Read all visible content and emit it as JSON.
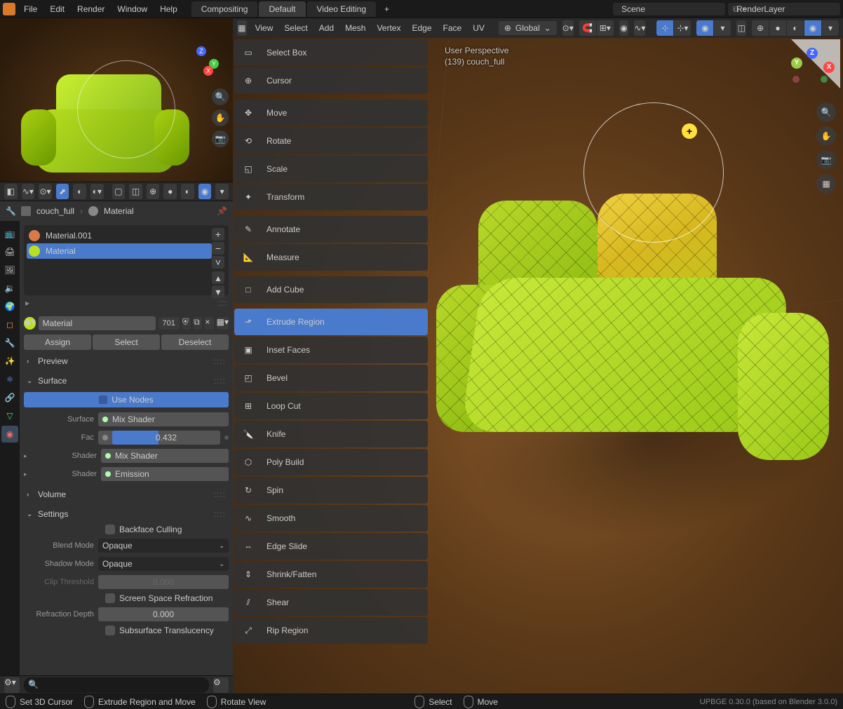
{
  "menu": {
    "file": "File",
    "edit": "Edit",
    "render": "Render",
    "window": "Window",
    "help": "Help"
  },
  "workspace_tabs": {
    "compositing": "Compositing",
    "default": "Default",
    "video_editing": "Video Editing"
  },
  "scene": {
    "label": "Scene"
  },
  "renderlayer": {
    "label": "RenderLayer"
  },
  "breadcrumb": {
    "object": "couch_full",
    "material": "Material"
  },
  "material_list": [
    {
      "name": "Material.001",
      "color": "#d87a4a"
    },
    {
      "name": "Material",
      "color": "#b8e020"
    }
  ],
  "material_name": "Material",
  "material_users": "701",
  "material_buttons": {
    "assign": "Assign",
    "select": "Select",
    "deselect": "Deselect"
  },
  "panels": {
    "preview": "Preview",
    "surface": "Surface",
    "volume": "Volume",
    "settings": "Settings",
    "use_nodes": "Use Nodes"
  },
  "surface_props": {
    "surface_lbl": "Surface",
    "surface_val": "Mix Shader",
    "fac_lbl": "Fac",
    "fac_val": "0.432",
    "shader1_lbl": "Shader",
    "shader1_val": "Mix Shader",
    "shader2_lbl": "Shader",
    "shader2_val": "Emission"
  },
  "settings_props": {
    "backface": "Backface Culling",
    "blend_lbl": "Blend Mode",
    "blend_val": "Opaque",
    "shadow_lbl": "Shadow Mode",
    "shadow_val": "Opaque",
    "clip_lbl": "Clip Threshold",
    "clip_val": "0.000",
    "ssr": "Screen Space Refraction",
    "refr_lbl": "Refraction Depth",
    "refr_val": "0.000",
    "sss": "Subsurface Translucency"
  },
  "v3d_menu": {
    "view": "View",
    "select": "Select",
    "add": "Add",
    "mesh": "Mesh",
    "vertex": "Vertex",
    "edge": "Edge",
    "face": "Face",
    "uv": "UV"
  },
  "orientation": "Global",
  "tools": [
    {
      "id": "select-box",
      "label": "Select Box"
    },
    {
      "id": "cursor",
      "label": "Cursor"
    },
    {
      "gap": true
    },
    {
      "id": "move",
      "label": "Move"
    },
    {
      "id": "rotate",
      "label": "Rotate"
    },
    {
      "id": "scale",
      "label": "Scale"
    },
    {
      "id": "transform",
      "label": "Transform"
    },
    {
      "gap": true
    },
    {
      "id": "annotate",
      "label": "Annotate"
    },
    {
      "id": "measure",
      "label": "Measure"
    },
    {
      "gap": true
    },
    {
      "id": "add-cube",
      "label": "Add Cube"
    },
    {
      "gap": true
    },
    {
      "id": "extrude-region",
      "label": "Extrude Region",
      "active": true
    },
    {
      "id": "inset-faces",
      "label": "Inset Faces"
    },
    {
      "id": "bevel",
      "label": "Bevel"
    },
    {
      "id": "loop-cut",
      "label": "Loop Cut"
    },
    {
      "id": "knife",
      "label": "Knife"
    },
    {
      "id": "poly-build",
      "label": "Poly Build"
    },
    {
      "id": "spin",
      "label": "Spin"
    },
    {
      "id": "smooth",
      "label": "Smooth"
    },
    {
      "id": "edge-slide",
      "label": "Edge Slide"
    },
    {
      "id": "shrink-fatten",
      "label": "Shrink/Fatten"
    },
    {
      "id": "shear",
      "label": "Shear"
    },
    {
      "id": "rip-region",
      "label": "Rip Region"
    }
  ],
  "overlay": {
    "l1": "User Perspective",
    "l2": "(139) couch_full"
  },
  "axes": {
    "x": "X",
    "y": "Y",
    "z": "Z"
  },
  "status": {
    "s1": "Set 3D Cursor",
    "s2": "Extrude Region and Move",
    "s3": "Rotate View",
    "s4": "Select",
    "s5": "Move"
  },
  "version": "UPBGE 0.30.0 (based on Blender 3.0.0)",
  "search_placeholder": ""
}
